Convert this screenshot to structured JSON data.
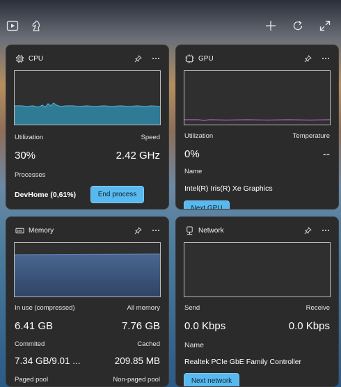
{
  "topbar": {
    "left_icons": [
      "play-icon",
      "chess-knight-icon"
    ],
    "right_icons": [
      "add-icon",
      "refresh-icon",
      "expand-icon"
    ]
  },
  "cpu": {
    "title": "CPU",
    "utilization_label": "Utilization",
    "speed_label": "Speed",
    "utilization_value": "30%",
    "speed_value": "2.42 GHz",
    "processes_label": "Processes",
    "top_process": "DevHome (0,61%)",
    "end_process_label": "End process"
  },
  "gpu": {
    "title": "GPU",
    "utilization_label": "Utilization",
    "temperature_label": "Temperature",
    "utilization_value": "0%",
    "temperature_value": "--",
    "name_label": "Name",
    "name_value": "Intel(R) Iris(R) Xe Graphics",
    "next_label": "Next GPU"
  },
  "memory": {
    "title": "Memory",
    "in_use_label": "In use (compressed)",
    "all_memory_label": "All memory",
    "in_use_value": "6.41 GB",
    "all_memory_value": "7.76 GB",
    "committed_label": "Commited",
    "cached_label": "Cached",
    "committed_value": "7.34 GB/9.01 ...",
    "cached_value": "209.85 MB",
    "paged_pool_label": "Paged pool",
    "non_paged_pool_label": "Non-paged pool"
  },
  "network": {
    "title": "Network",
    "send_label": "Send",
    "receive_label": "Receive",
    "send_value": "0.0 Kbps",
    "receive_value": "0.0 Kbps",
    "name_label": "Name",
    "name_value": "Realtek PCIe GbE Family Controller",
    "next_label": "Next network"
  },
  "colors": {
    "cpu_graph": "#3d8aa8",
    "gpu_graph": "#b061c4",
    "memory_graph": "#3e5a82",
    "button": "#58b9ee"
  }
}
